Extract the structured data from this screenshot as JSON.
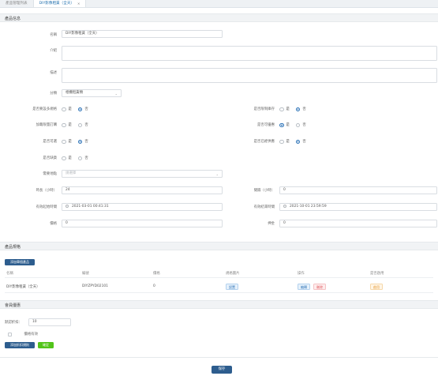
{
  "tabs": [
    {
      "label": "產品管理列表",
      "active": false
    },
    {
      "label": "DIY影像租賃（全天）",
      "active": true
    }
  ],
  "sections": {
    "product_info": "產品信息",
    "product_spec": "產品規格",
    "member_discount": "會員優惠"
  },
  "form": {
    "name_label": "名稱",
    "name_value": "DIY影像租賃（全天）",
    "intro_label": "介紹",
    "desc_label": "描述",
    "category_label": "分類",
    "category_value": "相機租賃類",
    "require_spec_label": "是否要設多規格",
    "no_stock_label": "是否限制庫存",
    "allow_online_label": "加載限量訂購",
    "allow_coupon_label": "是否可優惠",
    "required_label": "是否可選",
    "need_review_label": "是否已經供應",
    "on_sale_label": "是否缺貨",
    "pickup_label": "需要地點",
    "pickup_placeholder": "請選擇",
    "duration_label": "時長（小時）",
    "duration_value": "24",
    "interval_label": "間隔（小時）",
    "interval_value": "0",
    "valid_start_label": "有效起始時間",
    "valid_start_value": "2021-03-01 00:41:31",
    "valid_end_label": "有效結束時間",
    "valid_end_value": "2021-10-01 23:59:59",
    "price_label": "價格",
    "price_value": "0",
    "deposit_label": "押金",
    "deposit_value": "0",
    "yes": "是",
    "no": "否"
  },
  "spec": {
    "add_button": "添加單個產品",
    "columns": [
      "名稱",
      "編號",
      "價格",
      "規格圖片",
      "操作",
      "是否啟用"
    ],
    "rows": [
      {
        "name": "DIY影像租賃（全天）",
        "code": "DIYZPYD02101",
        "price": "0",
        "image_btn": "設置",
        "edit": "編輯",
        "delete": "刪除",
        "status": "啟用"
      }
    ]
  },
  "member": {
    "default_discount_label": "默認折扣：",
    "default_discount_value": "10",
    "price_discount_label": "價格有效",
    "add_discount_button": "添加折扣規則",
    "confirm_button": "確定"
  },
  "save_button": "保存",
  "colors": {
    "accent": "#2d5d8e",
    "radio_on": "#2f74b8",
    "green": "#52c41a"
  }
}
